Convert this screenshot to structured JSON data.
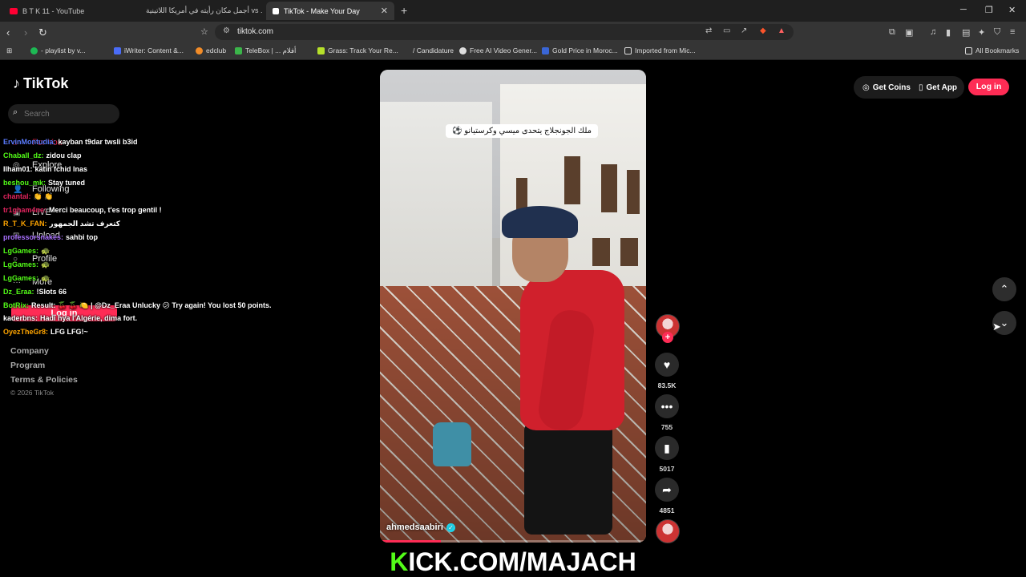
{
  "browser": {
    "tabs": [
      {
        "title": "B T K 11 - YouTube",
        "favicon_color": "#ff0033",
        "active": false
      },
      {
        "title": "أجمل مكان رأيته في أمريكا اللاتينية vs ...",
        "favicon_color": "#ff0033",
        "active": false
      },
      {
        "title": "TikTok - Make Your Day",
        "favicon_color": "#ffffff",
        "active": true
      }
    ],
    "url": "tiktok.com",
    "bookmarks": [
      {
        "label": "- playlist by v...",
        "color": "#1db954"
      },
      {
        "label": "iWriter: Content &...",
        "color": "#4a6cf7"
      },
      {
        "label": "edclub",
        "color": "#f28c28"
      },
      {
        "label": "TeleBox | ... أفلام",
        "color": "#3bb54a"
      },
      {
        "label": "Grass: Track Your Re...",
        "color": "#b6e02a"
      },
      {
        "label": "/ Candidature",
        "color": "#888888"
      },
      {
        "label": "Free AI Video Gener...",
        "color": "#dddddd"
      },
      {
        "label": "Gold Price in Moroc...",
        "color": "#3a66d6"
      },
      {
        "label": "Imported from Mic...",
        "color": "#dddddd"
      }
    ],
    "all_bookmarks": "All Bookmarks"
  },
  "tiktok": {
    "brand": "TikTok",
    "search_placeholder": "Search",
    "nav": [
      {
        "label": "For You",
        "icon": "home-icon"
      },
      {
        "label": "Explore",
        "icon": "compass-icon"
      },
      {
        "label": "Following",
        "icon": "people-icon"
      },
      {
        "label": "LIVE",
        "icon": "live-icon"
      },
      {
        "label": "Upload",
        "icon": "upload-icon"
      },
      {
        "label": "Profile",
        "icon": "profile-icon"
      },
      {
        "label": "More",
        "icon": "more-icon"
      }
    ],
    "sidebar_login": "Log in",
    "footer": [
      "Company",
      "Program",
      "Terms & Policies"
    ],
    "copyright": "© 2026 TikTok",
    "get_coins": "Get Coins",
    "get_app": "Get App",
    "login": "Log in",
    "caption": "ملك الجونجلاج يتحدى ميسي وكرستيانو ⚽",
    "author": "ahmedsaabiri",
    "progress": 0.23,
    "stats": {
      "likes": "83.5K",
      "comments": "755",
      "saves": "5017",
      "shares": "4851"
    }
  },
  "chat": [
    {
      "user": "ErvinMontudia:",
      "text": "kayban t9dar twsli b3id",
      "color": "#5b7cff"
    },
    {
      "user": "Chaball_dz:",
      "text": "zidou clap",
      "color": "#53fc18"
    },
    {
      "user": "Ilham01:",
      "text": "katin fchid Inas",
      "color": "#ffffff"
    },
    {
      "user": "beshou_mk:",
      "text": "Stay tuned",
      "color": "#53fc18"
    },
    {
      "user": "chantal:",
      "text": "👏 👏",
      "color": "#e0245e"
    },
    {
      "user": "tr1gham4ne:",
      "text": "Merci beaucoup, t'es trop gentil !",
      "color": "#e0245e"
    },
    {
      "user": "R_T_K_FAN:",
      "text": "كتعرف تشد الجمهور",
      "color": "#ffa500"
    },
    {
      "user": "professorsnakes:",
      "text": "sahbi top",
      "color": "#a970ff"
    },
    {
      "user": "LgGames:",
      "text": "🐢",
      "color": "#53fc18"
    },
    {
      "user": "LgGames:",
      "text": "🐢",
      "color": "#53fc18"
    },
    {
      "user": "LgGames:",
      "text": "🐢",
      "color": "#53fc18"
    },
    {
      "user": "Dz_Eraa:",
      "text": "!Slots 66",
      "color": "#53fc18"
    },
    {
      "user": "BotRix:",
      "text": "Result: 🍒 🍒 🍋 | @Dz_Eraa Unlucky 😕 Try again! You lost 50 points.",
      "color": "#53fc18"
    },
    {
      "user": "kaderbns:",
      "text": "Hadi hya l'Algérie, dima fort.",
      "color": "#ffffff"
    },
    {
      "user": "OyezTheGr8:",
      "text": "LFG LFG!~",
      "color": "#ffa500"
    }
  ],
  "stream_banner": {
    "k": "K",
    "rest": "ICK.COM/MAJACH",
    "color": "#53fc18"
  }
}
